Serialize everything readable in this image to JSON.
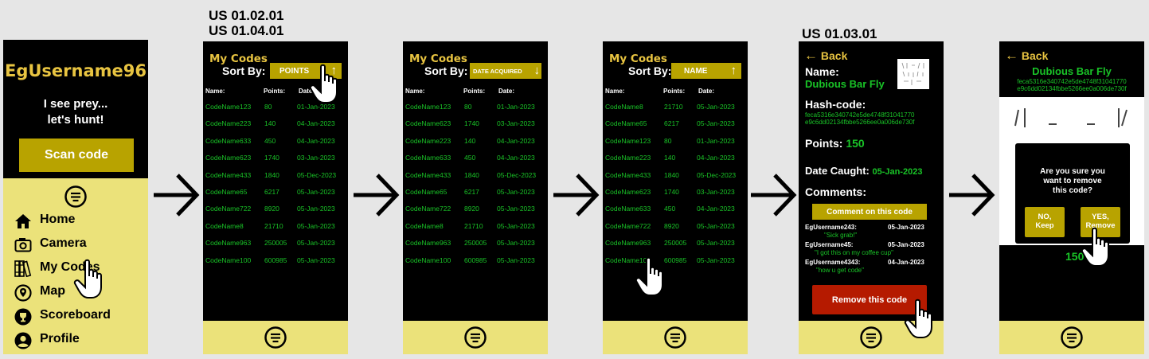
{
  "labels": {
    "us1": "US 01.02.01",
    "us2": "US 01.04.01",
    "us3": "US 01.03.01"
  },
  "home": {
    "username": "EgUsername96",
    "tagline1": "I see prey...",
    "tagline2": "let's hunt!",
    "scan_label": "Scan code",
    "menu": [
      "Home",
      "Camera",
      "My Codes",
      "Map",
      "Scoreboard",
      "Profile"
    ]
  },
  "codes": {
    "title": "My Codes",
    "sort_label": "Sort By:",
    "col_name": "Name:",
    "col_points": "Points:",
    "col_date": "Date:",
    "sort_points": "POINTS",
    "sort_date": "DATE ACQUIRED",
    "sort_name": "NAME",
    "list_points": [
      [
        "CodeName123",
        "80",
        "01-Jan-2023"
      ],
      [
        "CodeName223",
        "140",
        "04-Jan-2023"
      ],
      [
        "CodeName633",
        "450",
        "04-Jan-2023"
      ],
      [
        "CodeName623",
        "1740",
        "03-Jan-2023"
      ],
      [
        "CodeName433",
        "1840",
        "05-Dec-2023"
      ],
      [
        "CodeName65",
        "6217",
        "05-Jan-2023"
      ],
      [
        "CodeName722",
        "8920",
        "05-Jan-2023"
      ],
      [
        "CodeName8",
        "21710",
        "05-Jan-2023"
      ],
      [
        "CodeName963",
        "250005",
        "05-Jan-2023"
      ],
      [
        "CodeName100",
        "600985",
        "05-Jan-2023"
      ]
    ],
    "list_date": [
      [
        "CodeName123",
        "80",
        "01-Jan-2023"
      ],
      [
        "CodeName623",
        "1740",
        "03-Jan-2023"
      ],
      [
        "CodeName223",
        "140",
        "04-Jan-2023"
      ],
      [
        "CodeName633",
        "450",
        "04-Jan-2023"
      ],
      [
        "CodeName433",
        "1840",
        "05-Dec-2023"
      ],
      [
        "CodeName65",
        "6217",
        "05-Jan-2023"
      ],
      [
        "CodeName722",
        "8920",
        "05-Jan-2023"
      ],
      [
        "CodeName8",
        "21710",
        "05-Jan-2023"
      ],
      [
        "CodeName963",
        "250005",
        "05-Jan-2023"
      ],
      [
        "CodeName100",
        "600985",
        "05-Jan-2023"
      ]
    ],
    "list_name": [
      [
        "CodeName8",
        "21710",
        "05-Jan-2023"
      ],
      [
        "CodeName65",
        "6217",
        "05-Jan-2023"
      ],
      [
        "CodeName123",
        "80",
        "01-Jan-2023"
      ],
      [
        "CodeName223",
        "140",
        "04-Jan-2023"
      ],
      [
        "CodeName433",
        "1840",
        "05-Dec-2023"
      ],
      [
        "CodeName623",
        "1740",
        "03-Jan-2023"
      ],
      [
        "CodeName633",
        "450",
        "04-Jan-2023"
      ],
      [
        "CodeName722",
        "8920",
        "05-Jan-2023"
      ],
      [
        "CodeName963",
        "250005",
        "05-Jan-2023"
      ],
      [
        "CodeName100",
        "600985",
        "05-Jan-2023"
      ]
    ]
  },
  "detail": {
    "back": "Back",
    "name_label": "Name:",
    "name_value": "Dubious Bar Fly",
    "hash_label": "Hash-code:",
    "hash_value1": "feca5316e340742e5de4748f31041770",
    "hash_value2": "e9c6dd02134fbbe5266ee0a006de730f",
    "points_label": "Points:",
    "points_value": "150",
    "date_label": "Date Caught:",
    "date_value": "05-Jan-2023",
    "comments_label": "Comments:",
    "comment_btn": "Comment on this code",
    "comments": [
      {
        "user": "EgUsername243:",
        "date": "05-Jan-2023",
        "text": "\"Sick grab!\""
      },
      {
        "user": "EgUsername45:",
        "date": "05-Jan-2023",
        "text": "\"I got this on my coffee cup\""
      },
      {
        "user": "EgUsername4343:",
        "date": "04-Jan-2023",
        "text": "\"how u get code\""
      }
    ],
    "remove_btn": "Remove this code"
  },
  "confirm": {
    "back": "Back",
    "title": "Dubious Bar Fly",
    "hash1": "feca5316e340742e5de4748f31041770",
    "hash2": "e9c6dd02134fbbe5266ee0a006de730f",
    "dialog1": "Are you sure you",
    "dialog2": "want to remove",
    "dialog3": "this code?",
    "no1": "NO,",
    "no2": "Keep",
    "yes1": "YES,",
    "yes2": "Remove",
    "points_partial": "150 pt"
  },
  "colors": {
    "accent": "#b8a300",
    "green": "#19c427",
    "yellow": "#ebe27a",
    "remove": "#b51a00"
  }
}
